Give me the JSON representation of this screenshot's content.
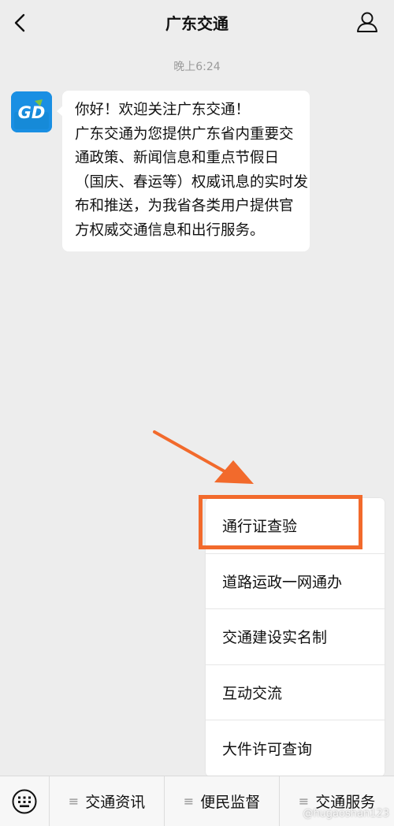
{
  "header": {
    "title": "广东交通"
  },
  "chat": {
    "time": "晚上6:24",
    "avatar_text": "GD",
    "message_lines": [
      "你好！欢迎关注广东交通！",
      "广东交通为您提供广东省内重要交",
      "通政策、新闻信息和重点节假日",
      "（国庆、春运等）权威讯息的实时发",
      "布和推送，为我省各类用户提供官",
      "方权威交通信息和出行服务。"
    ]
  },
  "menu": {
    "items": [
      {
        "label": "通行证查验",
        "highlighted": true
      },
      {
        "label": "道路运政一网通办"
      },
      {
        "label": "交通建设实名制"
      },
      {
        "label": "互动交流"
      },
      {
        "label": "大件许可查询"
      }
    ]
  },
  "bottom_bar": {
    "tabs": [
      {
        "icon": "≡",
        "label": "交通资讯"
      },
      {
        "icon": "≡",
        "label": "便民监督"
      },
      {
        "icon": "≡",
        "label": "交通服务"
      }
    ]
  },
  "watermark": "@hugaoshan123",
  "colors": {
    "background": "#ededed",
    "highlight": "#f26a2c",
    "avatar": "#1a8fe3",
    "logo_green": "#7dc242"
  }
}
